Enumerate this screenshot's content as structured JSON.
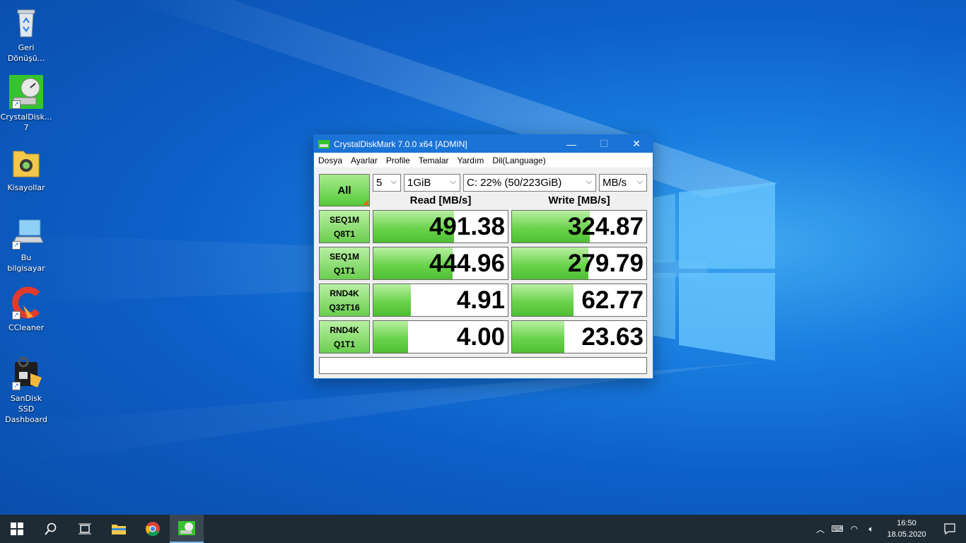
{
  "desktop": {
    "icons": [
      {
        "label": "Geri Dönüşü...",
        "icon": "recycle-bin-icon"
      },
      {
        "label": "CrystalDisk... 7",
        "icon": "crystaldiskmark-icon"
      },
      {
        "label": "Kisayollar",
        "icon": "folder-icon"
      },
      {
        "label": "Bu bilgisayar",
        "icon": "computer-icon"
      },
      {
        "label": "CCleaner",
        "icon": "ccleaner-icon"
      },
      {
        "label": "SanDisk SSD Dashboard",
        "icon": "sandisk-icon"
      }
    ]
  },
  "window": {
    "title": "CrystalDiskMark 7.0.0 x64 [ADMIN]",
    "menu": [
      "Dosya",
      "Ayarlar",
      "Profile",
      "Temalar",
      "Yardım",
      "Dil(Language)"
    ],
    "all_button": "All",
    "controls": {
      "count": "5",
      "size": "1GiB",
      "drive": "C: 22% (50/223GiB)",
      "unit": "MB/s"
    },
    "headers": {
      "read": "Read [MB/s]",
      "write": "Write [MB/s]"
    },
    "rows": [
      {
        "test_line1": "SEQ1M",
        "test_line2": "Q8T1",
        "read": "491.38",
        "write": "324.87",
        "read_fill": 0.6,
        "write_fill": 0.58
      },
      {
        "test_line1": "SEQ1M",
        "test_line2": "Q1T1",
        "read": "444.96",
        "write": "279.79",
        "read_fill": 0.59,
        "write_fill": 0.57
      },
      {
        "test_line1": "RND4K",
        "test_line2": "Q32T16",
        "read": "4.91",
        "write": "62.77",
        "read_fill": 0.28,
        "write_fill": 0.46
      },
      {
        "test_line1": "RND4K",
        "test_line2": "Q1T1",
        "read": "4.00",
        "write": "23.63",
        "read_fill": 0.26,
        "write_fill": 0.39
      }
    ],
    "comment": ""
  },
  "taskbar": {
    "time": "16:50",
    "date": "18.05.2020",
    "accent": "#76b9ed"
  }
}
